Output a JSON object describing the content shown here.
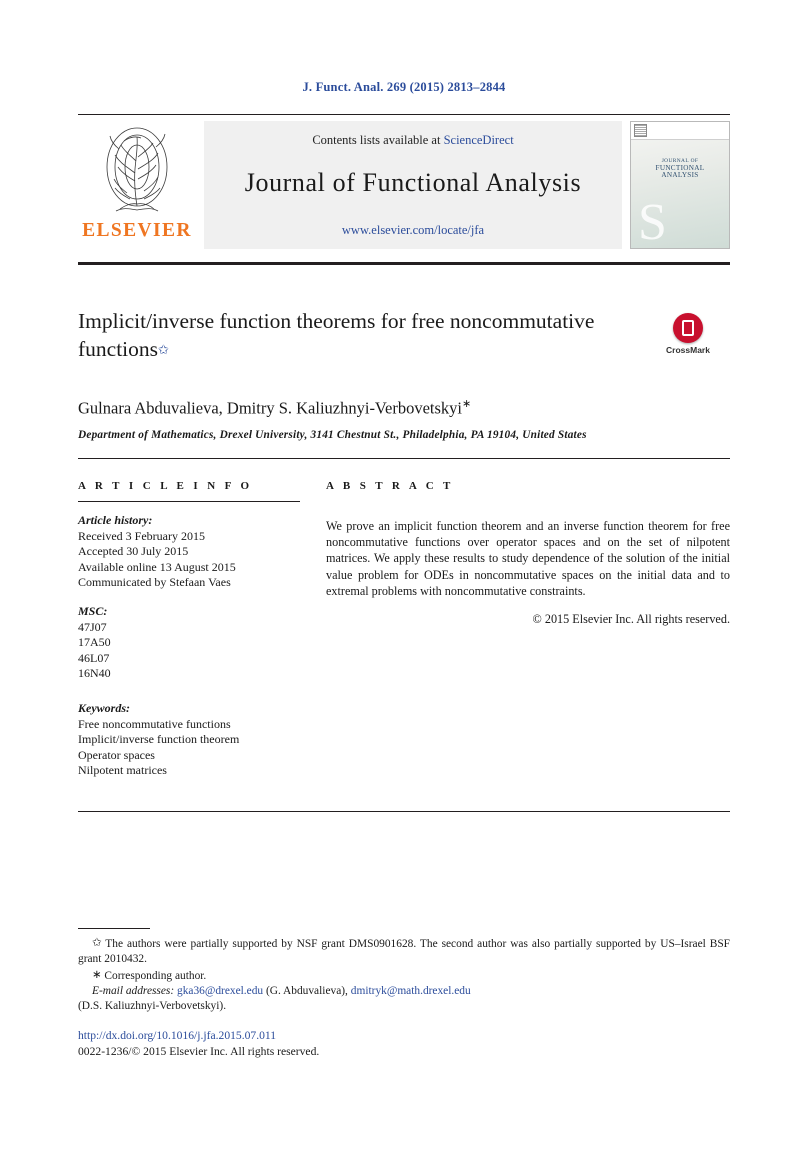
{
  "journal_ref": "J. Funct. Anal. 269 (2015) 2813–2844",
  "masthead": {
    "publisher": "ELSEVIER",
    "contents_prefix": "Contents lists available at",
    "contents_link": "ScienceDirect",
    "journal_title": "Journal of Functional Analysis",
    "journal_url": "www.elsevier.com/locate/jfa",
    "cover_line1": "JOURNAL OF",
    "cover_line2": "FUNCTIONAL",
    "cover_line3": "ANALYSIS",
    "cover_letter": "S"
  },
  "article": {
    "title": "Implicit/inverse function theorems for free noncommutative functions",
    "title_marker": "✩",
    "crossmark_label": "CrossMark",
    "authors": "Gulnara Abduvalieva, Dmitry S. Kaliuzhnyi-Verbovetskyi",
    "author_marker": "∗",
    "affiliation": "Department of Mathematics, Drexel University, 3141 Chestnut St., Philadelphia, PA 19104, United States"
  },
  "info": {
    "heading": "A R T I C L E    I N F O",
    "history_heading": "Article history:",
    "history": [
      "Received 3 February 2015",
      "Accepted 30 July 2015",
      "Available online 13 August 2015",
      "Communicated by Stefaan Vaes"
    ],
    "msc_heading": "MSC:",
    "msc": [
      "47J07",
      "17A50",
      "46L07",
      "16N40"
    ],
    "keywords_heading": "Keywords:",
    "keywords": [
      "Free noncommutative functions",
      "Implicit/inverse function theorem",
      "Operator spaces",
      "Nilpotent matrices"
    ]
  },
  "abstract": {
    "heading": "A B S T R A C T",
    "text": "We prove an implicit function theorem and an inverse function theorem for free noncommutative functions over operator spaces and on the set of nilpotent matrices. We apply these results to study dependence of the solution of the initial value problem for ODEs in noncommutative spaces on the initial data and to extremal problems with noncommutative constraints.",
    "copyright": "© 2015 Elsevier Inc. All rights reserved."
  },
  "footnotes": {
    "marker_star": "✩",
    "funding": "The authors were partially supported by NSF grant DMS0901628. The second author was also partially supported by US–Israel BSF grant 2010432.",
    "marker_asterisk": "∗",
    "corresponding": "Corresponding author.",
    "email_label": "E-mail addresses:",
    "email1": "gka36@drexel.edu",
    "email1_owner": "(G. Abduvalieva),",
    "email2": "dmitryk@math.drexel.edu",
    "email2_owner": "(D.S. Kaliuzhnyi-Verbovetskyi).",
    "doi": "http://dx.doi.org/10.1016/j.jfa.2015.07.011",
    "issn_copyright": "0022-1236/© 2015 Elsevier Inc. All rights reserved."
  }
}
